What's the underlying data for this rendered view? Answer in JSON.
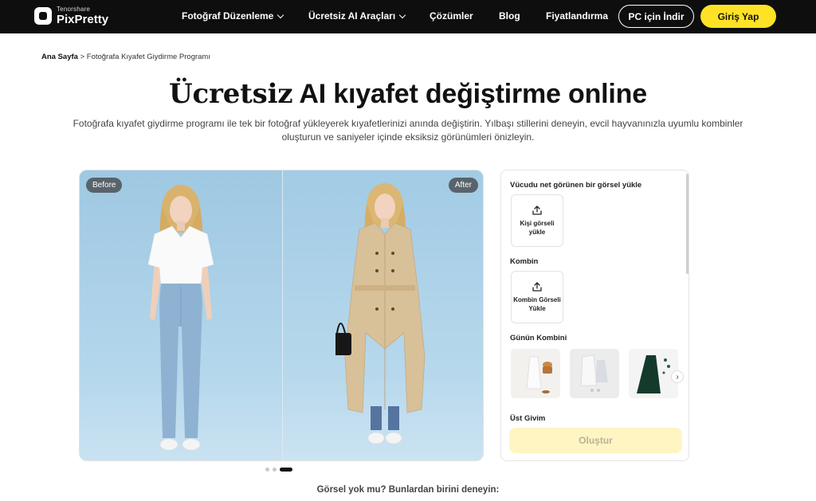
{
  "nav": {
    "logo_small": "Tenorshare",
    "logo_big": "PixPretty",
    "items": [
      {
        "label": "Fotoğraf Düzenleme",
        "dropdown": true
      },
      {
        "label": "Ücretsiz AI Araçları",
        "dropdown": true
      },
      {
        "label": "Çözümler",
        "dropdown": false
      },
      {
        "label": "Blog",
        "dropdown": false
      },
      {
        "label": "Fiyatlandırma",
        "dropdown": false
      }
    ],
    "download_label": "PC için İndir",
    "login_label": "Giriş Yap",
    "accent": "#ffe225"
  },
  "breadcrumb": {
    "home": "Ana Sayfa",
    "separator": " > ",
    "current": "Fotoğrafa Kıyafet Giydirme Programı"
  },
  "hero": {
    "title_highlight": "Ücretsiz",
    "title_rest": " AI kıyafet değiştirme online",
    "subtitle": "Fotoğrafa kıyafet giydirme programı ile tek bir fotoğraf yükleyerek kıyafetlerinizi anında değiştirin. Yılbaşı stillerini deneyin, evcil hayvanınızla uyumlu kombinler oluşturun ve saniyeler içinde eksiksiz görünümleri önizleyin."
  },
  "compare": {
    "before_label": "Before",
    "after_label": "After"
  },
  "carousel": {
    "count": 3,
    "active": 3
  },
  "panel": {
    "person_label": "Vücudu net görünen bir görsel yükle",
    "person_upload": "Kişi görseli yükle",
    "outfit_label": "Kombin",
    "outfit_upload": "Kombin Görseli Yükle",
    "daily_label": "Günün Kombini",
    "top_label": "Üst Givim",
    "create_label": "Oluştur",
    "thumbnails": [
      "white-dress-outfit",
      "white-coat-outfit",
      "green-gown-outfit"
    ]
  },
  "try_text": "Görsel yok mu? Bunlardan birini deneyin:"
}
